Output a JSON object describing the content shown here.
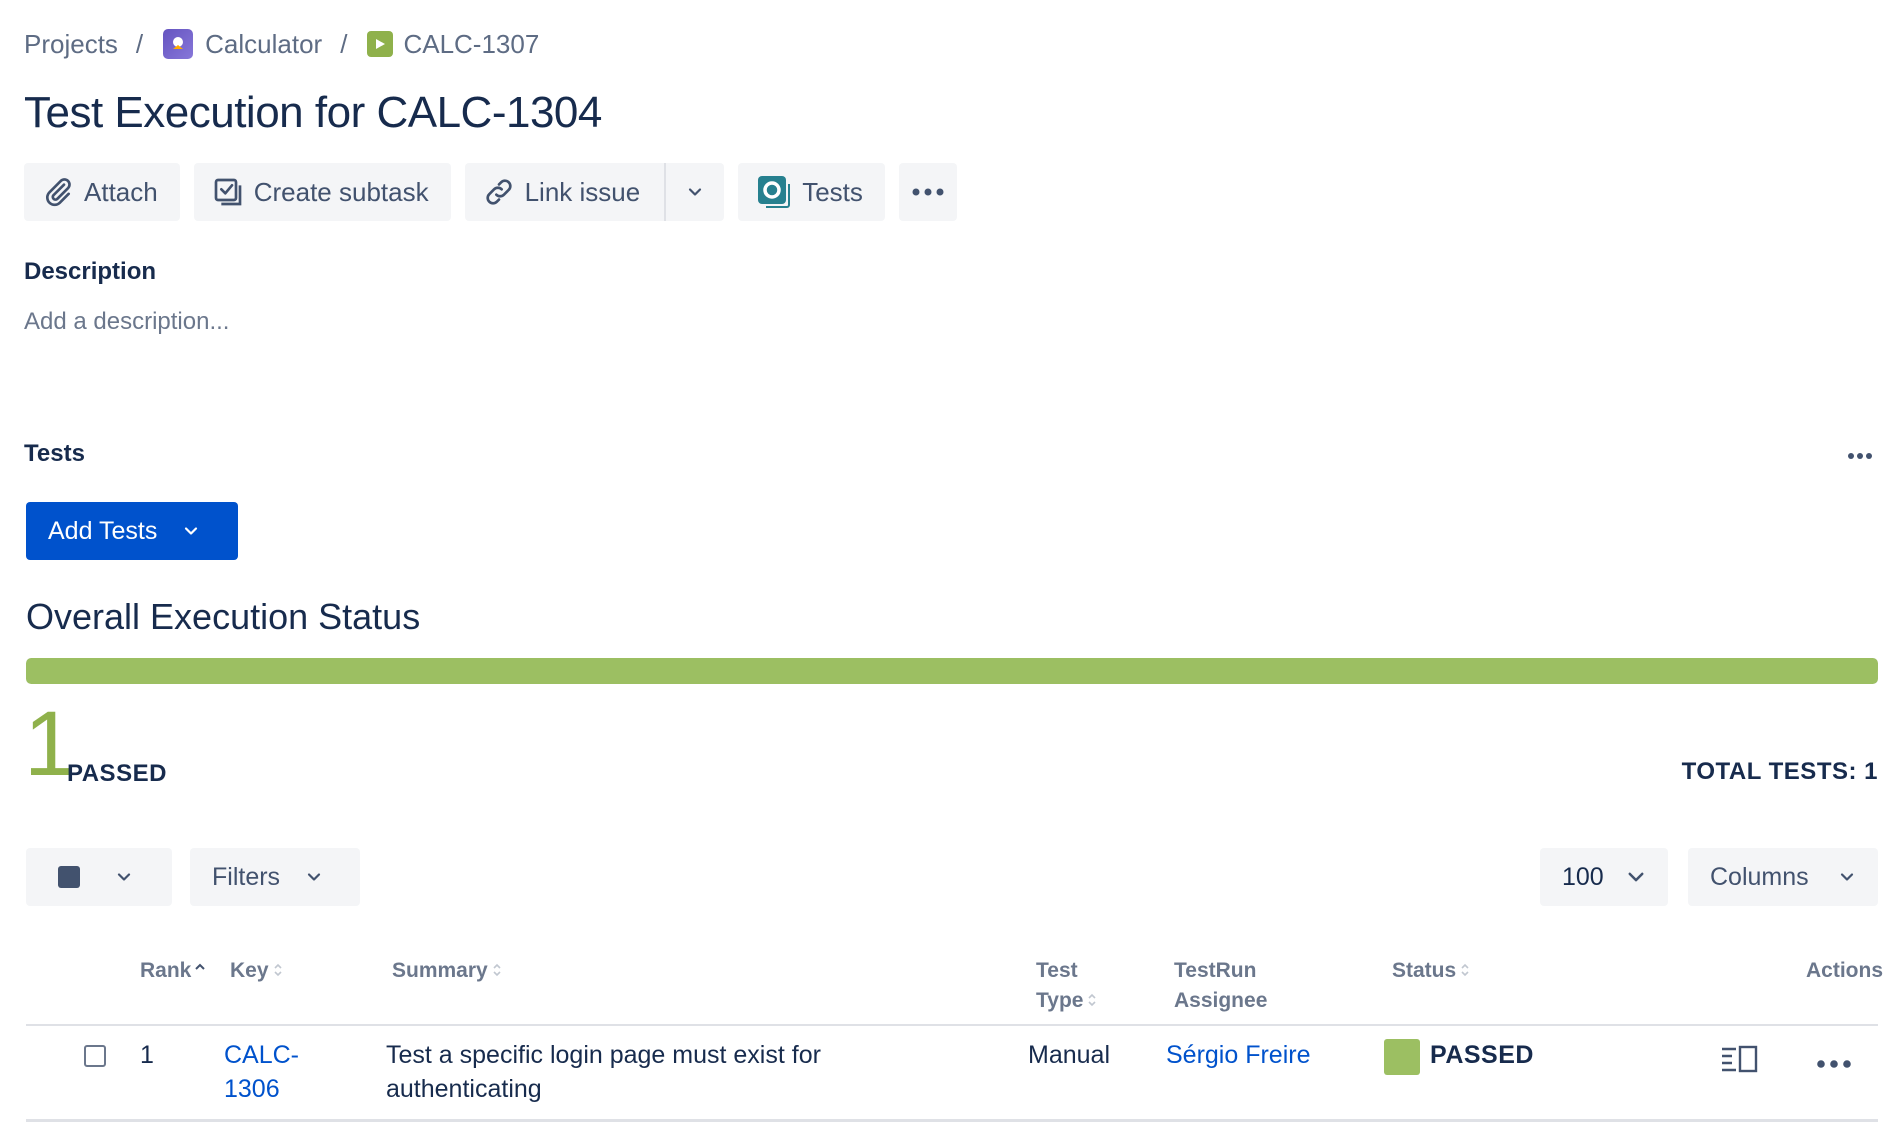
{
  "breadcrumb": {
    "projects": "Projects",
    "separator": "/",
    "project": "Calculator",
    "issue_key": "CALC-1307"
  },
  "issue": {
    "title": "Test Execution for CALC-1304"
  },
  "toolbar": {
    "attach": "Attach",
    "create_subtask": "Create subtask",
    "link_issue": "Link issue",
    "tests": "Tests"
  },
  "description": {
    "label": "Description",
    "placeholder": "Add a description..."
  },
  "tests_section": {
    "label": "Tests",
    "add_tests": "Add Tests"
  },
  "overall": {
    "title": "Overall Execution Status",
    "passed_fraction": 1.0,
    "passed_count": "1",
    "passed_label": "PASSED",
    "total_label": "TOTAL TESTS: 1",
    "pass_color": "#9cbf62"
  },
  "filter_bar": {
    "filters": "Filters",
    "page_size": "100",
    "columns": "Columns"
  },
  "table": {
    "headers": {
      "rank": "Rank",
      "key": "Key",
      "summary": "Summary",
      "test_type_1": "Test",
      "test_type_2": "Type",
      "assignee_1": "TestRun",
      "assignee_2": "Assignee",
      "status": "Status",
      "actions": "Actions"
    },
    "rows": [
      {
        "rank": "1",
        "key_1": "CALC-",
        "key_2": "1306",
        "summary_1": "Test a specific login page must exist for",
        "summary_2": "authenticating",
        "test_type": "Manual",
        "assignee": "Sérgio Freire",
        "status": "PASSED"
      }
    ]
  },
  "icons": {
    "attach": "paperclip-icon",
    "subtask": "subtask-icon",
    "link": "link-icon",
    "tests": "xray-tests-icon",
    "more": "more-icon",
    "details": "details-panel-icon"
  }
}
